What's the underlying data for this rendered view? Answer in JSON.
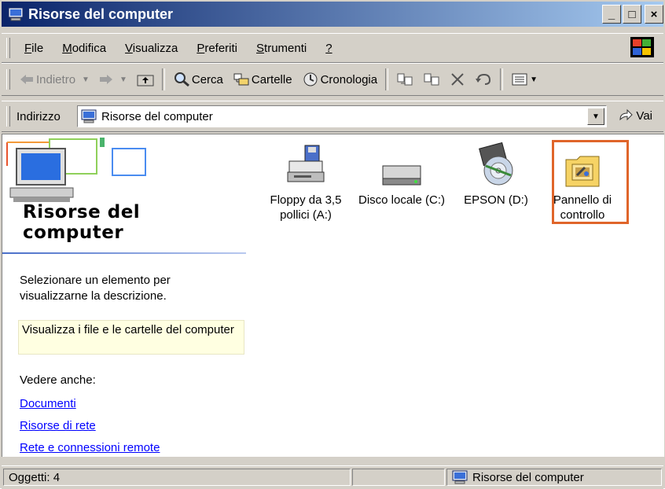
{
  "window": {
    "title": "Risorse del computer",
    "buttons": [
      "_",
      "□",
      "×"
    ]
  },
  "menu": {
    "items": [
      {
        "label": "File",
        "accel": "F"
      },
      {
        "label": "Modifica",
        "accel": "M"
      },
      {
        "label": "Visualizza",
        "accel": "V"
      },
      {
        "label": "Preferiti",
        "accel": "P"
      },
      {
        "label": "Strumenti",
        "accel": "S"
      },
      {
        "label": "?",
        "accel": "?"
      }
    ]
  },
  "toolbar": {
    "back_label": "Indietro",
    "search_label": "Cerca",
    "folders_label": "Cartelle",
    "history_label": "Cronologia"
  },
  "address": {
    "label": "Indirizzo",
    "value": "Risorse del computer",
    "go_label": "Vai"
  },
  "leftpane": {
    "title_line1": "Risorse del",
    "title_line2": "computer",
    "desc": "Selezionare un elemento per visualizzarne la descrizione.",
    "info": "Visualizza i file e le cartelle del computer",
    "see_also": "Vedere anche:",
    "links": [
      "Documenti",
      "Risorse di rete",
      "Rete e connessioni remote"
    ]
  },
  "icons": [
    {
      "name": "floppy-drive-icon",
      "label": "Floppy da 3,5 pollici (A:)"
    },
    {
      "name": "local-disk-icon",
      "label": "Disco locale (C:)"
    },
    {
      "name": "cd-drive-icon",
      "label": "EPSON (D:)"
    },
    {
      "name": "control-panel-icon",
      "label": "Pannello di controllo"
    }
  ],
  "status": {
    "objects": "Oggetti: 4",
    "location": "Risorse del computer"
  },
  "colors": {
    "highlight": "#e0652a",
    "link": "#0000ff"
  }
}
